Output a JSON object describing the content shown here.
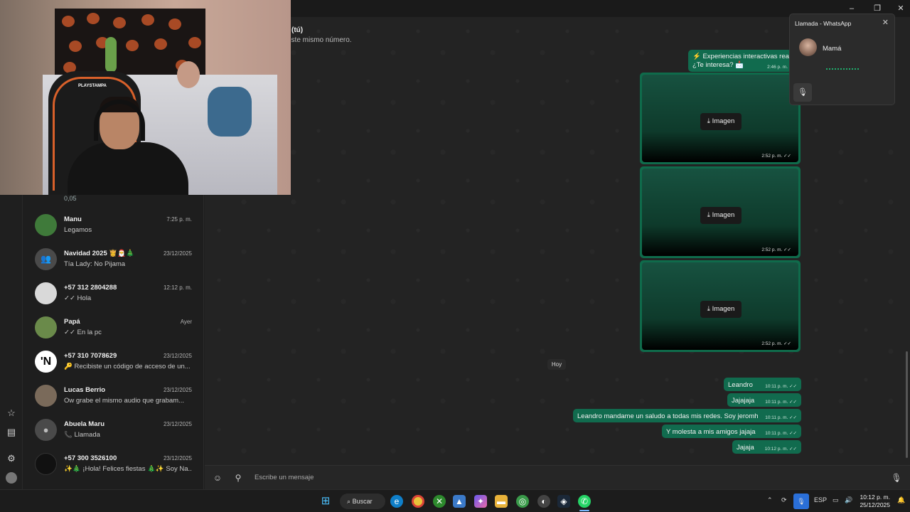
{
  "header": {
    "name_fragment": "(tú)",
    "subtitle_fragment": "este mismo número."
  },
  "chatlist": {
    "partial_preview": "0,05",
    "items": [
      {
        "name": "Manu",
        "time": "7:25 p. m.",
        "preview": "Legamos",
        "avatar_color": "#3f7a3a"
      },
      {
        "name": "Navidad 2025 👸🎅🎄",
        "time": "23/12/2025",
        "preview": "Tía Lady: No Pijama",
        "avatar_color": "#4a4a4a"
      },
      {
        "name": "+57 312 2804288",
        "time": "12:12 p. m.",
        "preview": "✓✓ Hola",
        "avatar_color": "#d9d9d9"
      },
      {
        "name": "Papá",
        "time": "Ayer",
        "preview": "✓✓ En la pc",
        "avatar_color": "#6a8a4a"
      },
      {
        "name": "+57 310 7078629",
        "time": "23/12/2025",
        "preview": "🔑 Recibiste un código de acceso de un...",
        "avatar_color": "#ffffff"
      },
      {
        "name": "Lucas Berrio",
        "time": "23/12/2025",
        "preview": "Ow grabe el mismo audio que grabam...",
        "avatar_color": "#7a6a5a"
      },
      {
        "name": "Abuela Maru",
        "time": "23/12/2025",
        "preview": "📞 Llamada",
        "avatar_color": "#4a4a4a"
      },
      {
        "name": "+57 300 3526100",
        "time": "23/12/2025",
        "preview": "✨🎄 ¡Hola! Felices fiestas 🎄✨ Soy Na...",
        "avatar_color": "#111111"
      }
    ]
  },
  "messages": {
    "top_bubble": {
      "line1": "⚡ Experiencias interactivas reales",
      "line2": "¿Te interesa? 📩",
      "time": "2:46 p. m."
    },
    "images": [
      {
        "label": "Imagen",
        "time": "2:52 p. m."
      },
      {
        "label": "Imagen",
        "time": "2:52 p. m."
      },
      {
        "label": "Imagen",
        "time": "2:52 p. m."
      }
    ],
    "day_separator": "Hoy",
    "texts": [
      {
        "text": "Leandro",
        "time": "10:11 p. m."
      },
      {
        "text": "Jajajaja",
        "time": "10:11 p. m."
      },
      {
        "text": "Leandro mandame un saludo a todas mis redes. Soy jeromh",
        "time": "10:11 p. m."
      },
      {
        "text": "Y molesta a mis amigos jajaja",
        "time": "10:11 p. m."
      },
      {
        "text": "Jajaja",
        "time": "10:12 p. m."
      }
    ]
  },
  "composer": {
    "placeholder": "Escribe un mensaje"
  },
  "call_popup": {
    "title": "Llamada - WhatsApp",
    "caller": "Mamá"
  },
  "webcam": {
    "chair_brand": "PLAYSTAMPA"
  },
  "taskbar": {
    "search_label": "Buscar",
    "language": "ESP",
    "clock_time": "10:12 p. m.",
    "clock_date": "25/12/2025"
  },
  "colors": {
    "accent": "#116b4e",
    "call_indicator": "#1fae6d"
  }
}
